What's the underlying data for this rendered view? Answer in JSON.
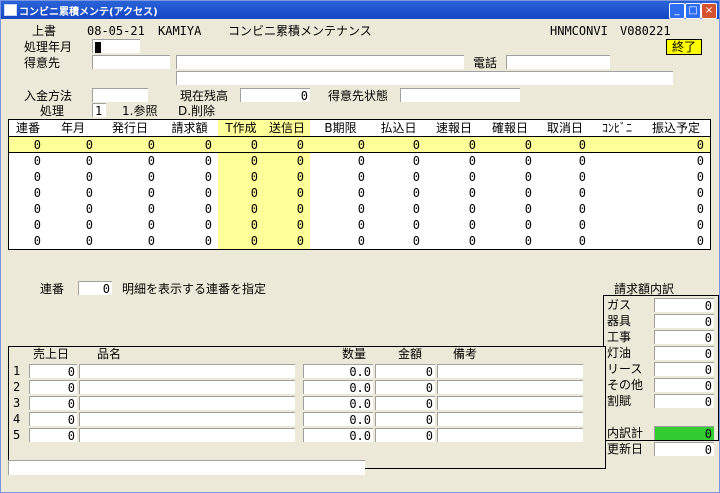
{
  "window": {
    "title": "コンビニ累積メンテ(アクセス)"
  },
  "header": {
    "mode": "上書",
    "date": "08-05-21",
    "user": "KAMIYA",
    "screen_title": "コンビニ累積メンテナンス",
    "program_id": "HNMCONVI",
    "version": "V080221",
    "end_button": "終了"
  },
  "form": {
    "period_label": "処理年月",
    "customer_label": "得意先",
    "phone_label": "電話",
    "payment_method_label": "入金方法",
    "current_balance_label": "現在残高",
    "current_balance_value": "0",
    "customer_status_label": "得意先状態",
    "process_label": "処理",
    "process_value": "1",
    "process_option1": "1.参照",
    "process_option2": "D.削除"
  },
  "grid1": {
    "headers": [
      "連番",
      "年月",
      "発行日",
      "請求額",
      "T作成",
      "送信日",
      "B期限",
      "払込日",
      "速報日",
      "確報日",
      "取消日",
      "ｺﾝﾋﾞﾆ",
      "振込予定"
    ],
    "rows": [
      [
        "0",
        "0",
        "0",
        "0",
        "0",
        "0",
        "0",
        "0",
        "0",
        "0",
        "0",
        "",
        "0"
      ],
      [
        "0",
        "0",
        "0",
        "0",
        "0",
        "0",
        "0",
        "0",
        "0",
        "0",
        "0",
        "",
        "0"
      ],
      [
        "0",
        "0",
        "0",
        "0",
        "0",
        "0",
        "0",
        "0",
        "0",
        "0",
        "0",
        "",
        "0"
      ],
      [
        "0",
        "0",
        "0",
        "0",
        "0",
        "0",
        "0",
        "0",
        "0",
        "0",
        "0",
        "",
        "0"
      ],
      [
        "0",
        "0",
        "0",
        "0",
        "0",
        "0",
        "0",
        "0",
        "0",
        "0",
        "0",
        "",
        "0"
      ],
      [
        "0",
        "0",
        "0",
        "0",
        "0",
        "0",
        "0",
        "0",
        "0",
        "0",
        "0",
        "",
        "0"
      ],
      [
        "0",
        "0",
        "0",
        "0",
        "0",
        "0",
        "0",
        "0",
        "0",
        "0",
        "0",
        "",
        "0"
      ]
    ]
  },
  "detail": {
    "seq_label": "連番",
    "seq_value": "0",
    "hint": "明細を表示する連番を指定"
  },
  "breakdown": {
    "title": "請求額内訳",
    "items": [
      {
        "label": "ガス",
        "value": "0"
      },
      {
        "label": "器具",
        "value": "0"
      },
      {
        "label": "工事",
        "value": "0"
      },
      {
        "label": "灯油",
        "value": "0"
      },
      {
        "label": "リース",
        "value": "0"
      },
      {
        "label": "その他",
        "value": "0"
      },
      {
        "label": "割賦",
        "value": "0"
      }
    ],
    "total_label": "内訳計",
    "total_value": "0",
    "updated_label": "更新日",
    "updated_value": "0",
    "total_color": "#33cc33"
  },
  "grid2": {
    "headers": {
      "sales_date": "売上日",
      "item_name": "品名",
      "quantity": "数量",
      "amount": "金額",
      "remarks": "備考"
    },
    "rows": [
      {
        "no": "1",
        "date": "0",
        "qty": "0.0",
        "amt": "0"
      },
      {
        "no": "2",
        "date": "0",
        "qty": "0.0",
        "amt": "0"
      },
      {
        "no": "3",
        "date": "0",
        "qty": "0.0",
        "amt": "0"
      },
      {
        "no": "4",
        "date": "0",
        "qty": "0.0",
        "amt": "0"
      },
      {
        "no": "5",
        "date": "0",
        "qty": "0.0",
        "amt": "0"
      }
    ]
  }
}
